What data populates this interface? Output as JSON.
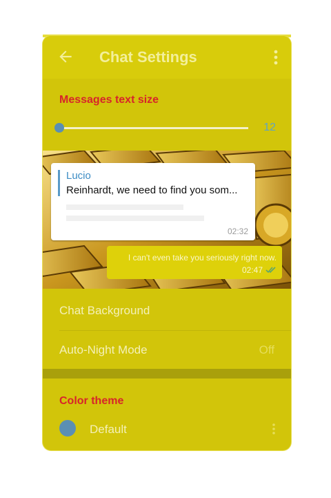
{
  "appbar": {
    "title": "Chat Settings",
    "back_icon": "arrow-back-icon",
    "menu_icon": "more-vert-icon"
  },
  "text_size": {
    "section_title": "Messages text size",
    "value": "12",
    "slider_fraction": 0.0
  },
  "preview": {
    "incoming": {
      "reply_name": "Lucio",
      "reply_text": "Reinhardt, we need to find you som...",
      "time": "02:32"
    },
    "outgoing": {
      "text": "I can't even take you seriously right now.",
      "time": "02:47",
      "status_icon": "double-check-icon"
    }
  },
  "settings": {
    "chat_background": "Chat Background",
    "auto_night_label": "Auto-Night Mode",
    "auto_night_value": "Off"
  },
  "color_theme": {
    "section_title": "Color theme",
    "item_label": "Default",
    "item_color": "#5b8fb3"
  },
  "colors": {
    "accent_yellow": "#d2c50a",
    "section_red": "#d7252a",
    "link_blue": "#5ea4c6"
  }
}
